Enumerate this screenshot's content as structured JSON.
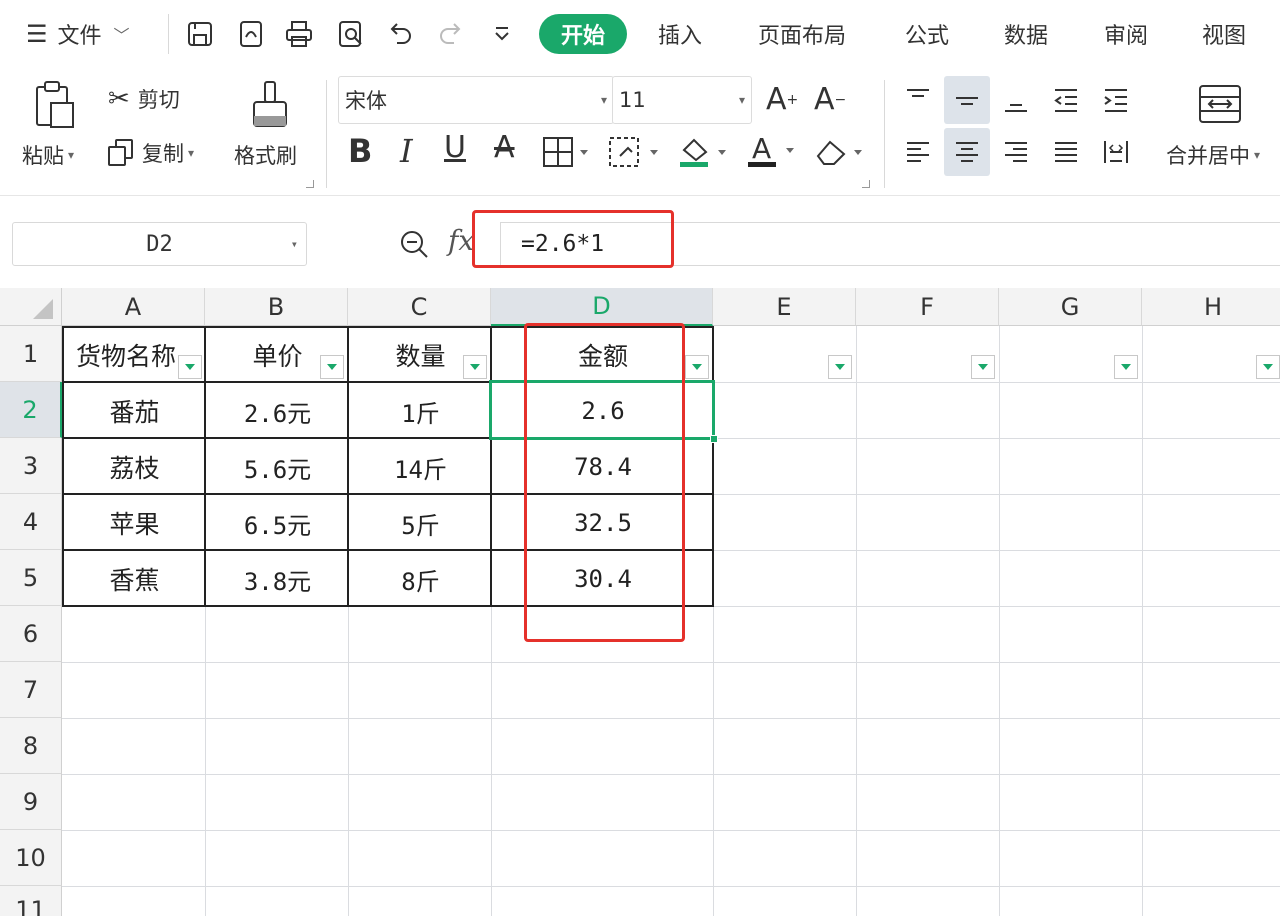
{
  "menu": {
    "file_label": "文件",
    "start_tab": "开始",
    "tabs": [
      "插入",
      "页面布局",
      "公式",
      "数据",
      "审阅",
      "视图"
    ]
  },
  "ribbon": {
    "paste_label": "粘贴",
    "cut_label": "剪切",
    "copy_label": "复制",
    "format_painter_label": "格式刷",
    "font_name": "宋体",
    "font_size": "11",
    "merge_center_label": "合并居中"
  },
  "formula_bar": {
    "name_box": "D2",
    "fx_label": "fx",
    "formula": "=2.6*1"
  },
  "sheet": {
    "columns": [
      "A",
      "B",
      "C",
      "D",
      "E",
      "F",
      "G",
      "H"
    ],
    "rows": [
      "1",
      "2",
      "3",
      "4",
      "5",
      "6",
      "7",
      "8",
      "9",
      "10",
      "11"
    ],
    "header": [
      "货物名称",
      "单价",
      "数量",
      "金额"
    ],
    "data": [
      [
        "番茄",
        "2.6元",
        "1斤",
        "2.6"
      ],
      [
        "荔枝",
        "5.6元",
        "14斤",
        "78.4"
      ],
      [
        "苹果",
        "6.5元",
        "5斤",
        "32.5"
      ],
      [
        "香蕉",
        "3.8元",
        "8斤",
        "30.4"
      ]
    ],
    "selected_cell": "D2"
  },
  "colors": {
    "accent": "#1aa86a",
    "highlight_box": "#e5312b"
  }
}
